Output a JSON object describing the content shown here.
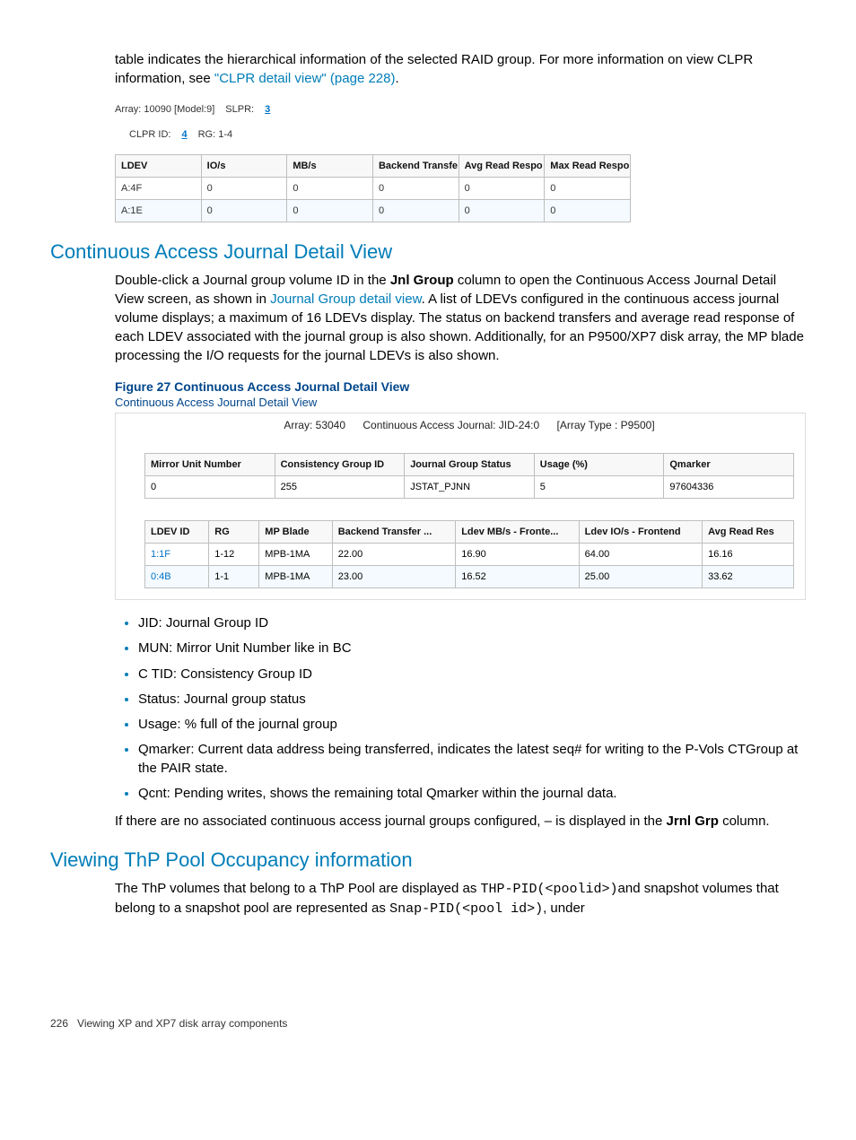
{
  "intro": {
    "text_before_link": "table indicates the hierarchical information of the selected RAID group. For more information on view CLPR information, see ",
    "link_text": "\"CLPR detail view\" (page 228)",
    "text_after_link": "."
  },
  "crumb1": {
    "array_model": "Array: 10090 [Model:9]",
    "slpr_label": "SLPR:",
    "slpr_link": "3"
  },
  "crumb2": {
    "clpr_label": "CLPR ID:",
    "clpr_link": "4",
    "rg_label": "RG: 1-4"
  },
  "ldev_table": {
    "headers": [
      "LDEV",
      "IO/s",
      "MB/s",
      "Backend Transfe",
      "Avg Read Respo",
      "Max Read Respo"
    ],
    "rows": [
      [
        "A:4F",
        "0",
        "0",
        "0",
        "0",
        "0"
      ],
      [
        "A:1E",
        "0",
        "0",
        "0",
        "0",
        "0"
      ]
    ]
  },
  "section1": {
    "heading": "Continuous Access Journal Detail View",
    "p_before": "Double-click a Journal group volume ID in the ",
    "p_bold": "Jnl Group",
    "p_mid": " column to open the Continuous Access Journal Detail View screen, as shown in ",
    "p_link": "Journal Group detail view",
    "p_after": ". A list of LDEVs configured in the continuous access journal volume displays; a maximum of 16 LDEVs display. The status on backend transfers and average read response of each LDEV associated with the journal group is also shown. Additionally, for an P9500/XP7 disk array, the MP blade processing the I/O requests for the journal LDEVs is also shown.",
    "figure_caption": "Figure 27 Continuous Access Journal Detail View"
  },
  "cajd": {
    "title": "Continuous Access Journal Detail View",
    "header_parts": {
      "array": "Array: 53040",
      "journal": "Continuous Access Journal: JID-24:0",
      "type": "[Array Type : P9500]"
    },
    "summary_headers": [
      "Mirror Unit Number",
      "Consistency Group ID",
      "Journal Group Status",
      "Usage (%)",
      "Qmarker"
    ],
    "summary_row": [
      "0",
      "255",
      "JSTAT_PJNN",
      "5",
      "97604336"
    ],
    "detail_headers": [
      "LDEV ID",
      "RG",
      "MP Blade",
      "Backend Transfer ...",
      "Ldev MB/s - Fronte...",
      "Ldev IO/s - Frontend",
      "Avg Read Res"
    ],
    "detail_col_widths": [
      70,
      55,
      80,
      135,
      135,
      135,
      100
    ],
    "detail_rows": [
      [
        "1:1F",
        "1-12",
        "MPB-1MA",
        "22.00",
        "16.90",
        "64.00",
        "16.16"
      ],
      [
        "0:4B",
        "1-1",
        "MPB-1MA",
        "23.00",
        "16.52",
        "25.00",
        "33.62"
      ]
    ]
  },
  "bullets": [
    "JID: Journal Group ID",
    "MUN: Mirror Unit Number like in BC",
    "C TID: Consistency Group ID",
    "Status: Journal group status",
    "Usage: % full of the journal group",
    "Qmarker: Current data address being transferred, indicates the latest seq# for writing to the P-Vols CTGroup at the PAIR state.",
    "Qcnt: Pending writes, shows the remaining total Qmarker within the journal data."
  ],
  "post_bullets": {
    "before_bold": "If there are no associated continuous access journal groups configured, – is displayed in the ",
    "bold": "Jrnl Grp",
    "after_bold": " column."
  },
  "section2": {
    "heading": "Viewing ThP Pool Occupancy information",
    "p_before_mono1": "The ThP volumes that belong to a ThP Pool are displayed as ",
    "mono1": "THP-PID(<poolid>)",
    "p_mid": "and snapshot volumes that belong to a snapshot pool are represented as ",
    "mono2": "Snap-PID(<pool id>)",
    "p_after": ", under"
  },
  "footer": {
    "page": "226",
    "title": "Viewing XP and XP7 disk array components"
  }
}
